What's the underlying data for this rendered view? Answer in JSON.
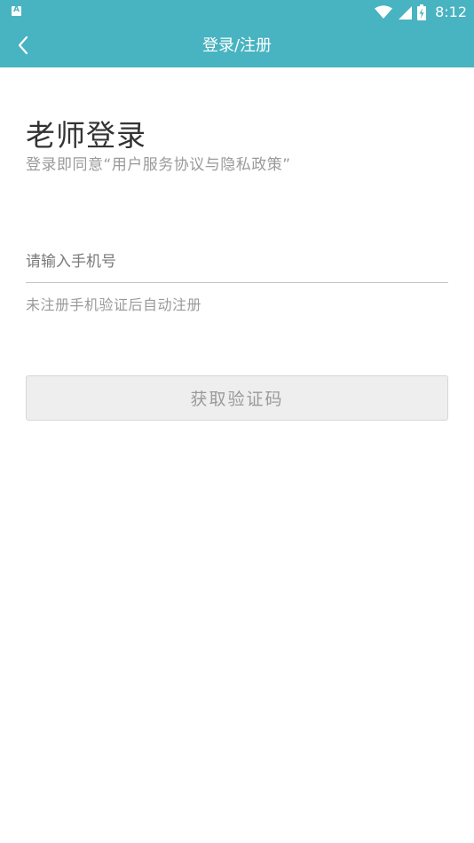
{
  "status_bar": {
    "left_icon": "A",
    "icons": [
      "wifi-icon",
      "signal-icon",
      "battery-charging-icon"
    ],
    "time": "8:12"
  },
  "app_bar": {
    "back_icon": "chevron-left-icon",
    "title": "登录/注册"
  },
  "login": {
    "title": "老师登录",
    "agreement": "登录即同意“用户服务协议与隐私政策”",
    "phone_placeholder": "请输入手机号",
    "phone_value": "",
    "hint": "未注册手机验证后自动注册",
    "get_code_label": "获取验证码"
  },
  "colors": {
    "brand": "#48b3c1",
    "button_bg": "#eeeeee",
    "button_text": "#9a9a9a"
  }
}
